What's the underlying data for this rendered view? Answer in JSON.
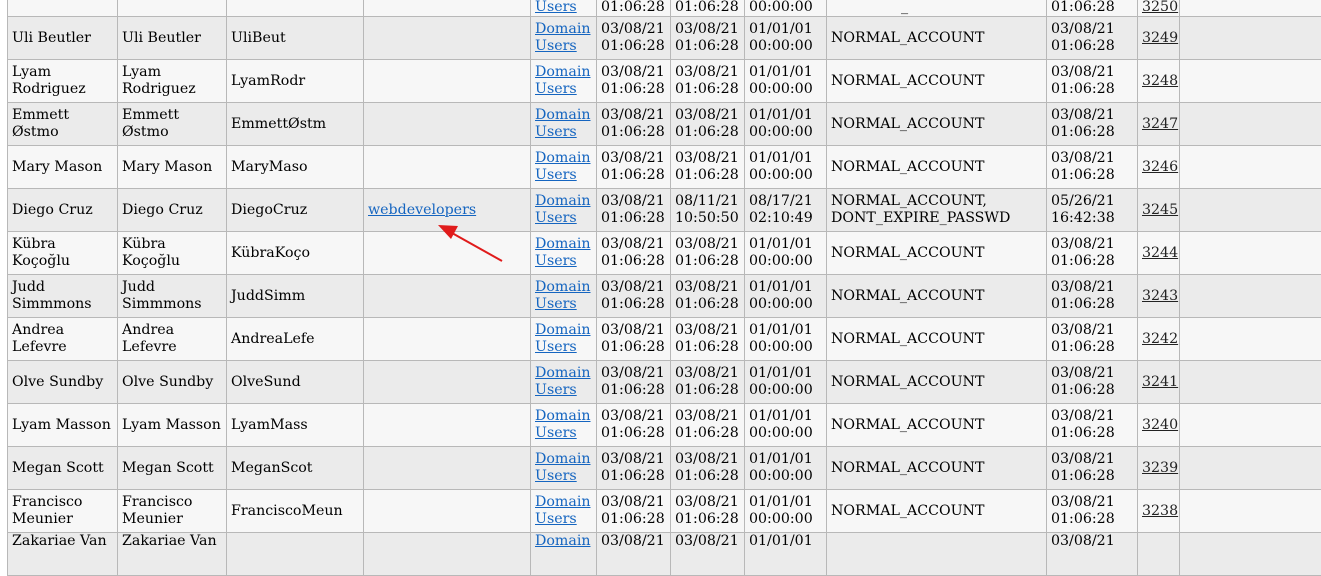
{
  "link_color": "#1565c0",
  "arrow_color": "#e01b1b",
  "top_partial": {
    "group_line1": "Users",
    "c1_line2": "01:06:28",
    "c2_line2": "01:06:28",
    "c3_line2": "00:00:00",
    "uac": "_",
    "c4_line2": "01:06:28",
    "rid": "3250"
  },
  "rows": [
    {
      "name": "Uli Beutler",
      "display": "Uli Beutler",
      "sam": "UliBeut",
      "member": "",
      "group_l1": "Domain",
      "group_l2": "Users",
      "c1a": "03/08/21",
      "c1b": "01:06:28",
      "c2a": "03/08/21",
      "c2b": "01:06:28",
      "c3a": "01/01/01",
      "c3b": "00:00:00",
      "uac": "NORMAL_ACCOUNT",
      "uac2": "",
      "c4a": "03/08/21",
      "c4b": "01:06:28",
      "rid": "3249"
    },
    {
      "name": "Lyam Rodriguez",
      "display": "Lyam Rodriguez",
      "sam": "LyamRodr",
      "member": "",
      "group_l1": "Domain",
      "group_l2": "Users",
      "c1a": "03/08/21",
      "c1b": "01:06:28",
      "c2a": "03/08/21",
      "c2b": "01:06:28",
      "c3a": "01/01/01",
      "c3b": "00:00:00",
      "uac": "NORMAL_ACCOUNT",
      "uac2": "",
      "c4a": "03/08/21",
      "c4b": "01:06:28",
      "rid": "3248"
    },
    {
      "name": "Emmett Østmo",
      "display": "Emmett Østmo",
      "sam": "EmmettØstm",
      "member": "",
      "group_l1": "Domain",
      "group_l2": "Users",
      "c1a": "03/08/21",
      "c1b": "01:06:28",
      "c2a": "03/08/21",
      "c2b": "01:06:28",
      "c3a": "01/01/01",
      "c3b": "00:00:00",
      "uac": "NORMAL_ACCOUNT",
      "uac2": "",
      "c4a": "03/08/21",
      "c4b": "01:06:28",
      "rid": "3247"
    },
    {
      "name": "Mary Mason",
      "display": "Mary Mason",
      "sam": "MaryMaso",
      "member": "",
      "group_l1": "Domain",
      "group_l2": "Users",
      "c1a": "03/08/21",
      "c1b": "01:06:28",
      "c2a": "03/08/21",
      "c2b": "01:06:28",
      "c3a": "01/01/01",
      "c3b": "00:00:00",
      "uac": "NORMAL_ACCOUNT",
      "uac2": "",
      "c4a": "03/08/21",
      "c4b": "01:06:28",
      "rid": "3246"
    },
    {
      "name": "Diego Cruz",
      "display": "Diego Cruz",
      "sam": "DiegoCruz",
      "member": "webdevelopers",
      "group_l1": "Domain",
      "group_l2": "Users",
      "c1a": "03/08/21",
      "c1b": "01:06:28",
      "c2a": "08/11/21",
      "c2b": "10:50:50",
      "c3a": "08/17/21",
      "c3b": "02:10:49",
      "uac": "NORMAL_ACCOUNT,",
      "uac2": "DONT_EXPIRE_PASSWD",
      "c4a": "05/26/21",
      "c4b": "16:42:38",
      "rid": "3245"
    },
    {
      "name": "Kübra Koçoğlu",
      "display": "Kübra Koçoğlu",
      "sam": "KübraKoço",
      "member": "",
      "group_l1": "Domain",
      "group_l2": "Users",
      "c1a": "03/08/21",
      "c1b": "01:06:28",
      "c2a": "03/08/21",
      "c2b": "01:06:28",
      "c3a": "01/01/01",
      "c3b": "00:00:00",
      "uac": "NORMAL_ACCOUNT",
      "uac2": "",
      "c4a": "03/08/21",
      "c4b": "01:06:28",
      "rid": "3244"
    },
    {
      "name": "Judd Simmmons",
      "display": "Judd Simmmons",
      "sam": "JuddSimm",
      "member": "",
      "group_l1": "Domain",
      "group_l2": "Users",
      "c1a": "03/08/21",
      "c1b": "01:06:28",
      "c2a": "03/08/21",
      "c2b": "01:06:28",
      "c3a": "01/01/01",
      "c3b": "00:00:00",
      "uac": "NORMAL_ACCOUNT",
      "uac2": "",
      "c4a": "03/08/21",
      "c4b": "01:06:28",
      "rid": "3243"
    },
    {
      "name": "Andrea Lefevre",
      "display": "Andrea Lefevre",
      "sam": "AndreaLefe",
      "member": "",
      "group_l1": "Domain",
      "group_l2": "Users",
      "c1a": "03/08/21",
      "c1b": "01:06:28",
      "c2a": "03/08/21",
      "c2b": "01:06:28",
      "c3a": "01/01/01",
      "c3b": "00:00:00",
      "uac": "NORMAL_ACCOUNT",
      "uac2": "",
      "c4a": "03/08/21",
      "c4b": "01:06:28",
      "rid": "3242"
    },
    {
      "name": "Olve Sundby",
      "display": "Olve Sundby",
      "sam": "OlveSund",
      "member": "",
      "group_l1": "Domain",
      "group_l2": "Users",
      "c1a": "03/08/21",
      "c1b": "01:06:28",
      "c2a": "03/08/21",
      "c2b": "01:06:28",
      "c3a": "01/01/01",
      "c3b": "00:00:00",
      "uac": "NORMAL_ACCOUNT",
      "uac2": "",
      "c4a": "03/08/21",
      "c4b": "01:06:28",
      "rid": "3241"
    },
    {
      "name": "Lyam Masson",
      "display": "Lyam Masson",
      "sam": "LyamMass",
      "member": "",
      "group_l1": "Domain",
      "group_l2": "Users",
      "c1a": "03/08/21",
      "c1b": "01:06:28",
      "c2a": "03/08/21",
      "c2b": "01:06:28",
      "c3a": "01/01/01",
      "c3b": "00:00:00",
      "uac": "NORMAL_ACCOUNT",
      "uac2": "",
      "c4a": "03/08/21",
      "c4b": "01:06:28",
      "rid": "3240"
    },
    {
      "name": "Megan Scott",
      "display": "Megan Scott",
      "sam": "MeganScot",
      "member": "",
      "group_l1": "Domain",
      "group_l2": "Users",
      "c1a": "03/08/21",
      "c1b": "01:06:28",
      "c2a": "03/08/21",
      "c2b": "01:06:28",
      "c3a": "01/01/01",
      "c3b": "00:00:00",
      "uac": "NORMAL_ACCOUNT",
      "uac2": "",
      "c4a": "03/08/21",
      "c4b": "01:06:28",
      "rid": "3239"
    },
    {
      "name": "Francisco Meunier",
      "display": "Francisco Meunier",
      "sam": "FranciscoMeun",
      "member": "",
      "group_l1": "Domain",
      "group_l2": "Users",
      "c1a": "03/08/21",
      "c1b": "01:06:28",
      "c2a": "03/08/21",
      "c2b": "01:06:28",
      "c3a": "01/01/01",
      "c3b": "00:00:00",
      "uac": "NORMAL_ACCOUNT",
      "uac2": "",
      "c4a": "03/08/21",
      "c4b": "01:06:28",
      "rid": "3238"
    }
  ],
  "bottom_partial": {
    "name": "Zakariae Van",
    "display": "Zakariae Van",
    "group_l1": "Domain",
    "c1a": "03/08/21",
    "c2a": "03/08/21",
    "c3a": "01/01/01",
    "c4a": "03/08/21"
  }
}
